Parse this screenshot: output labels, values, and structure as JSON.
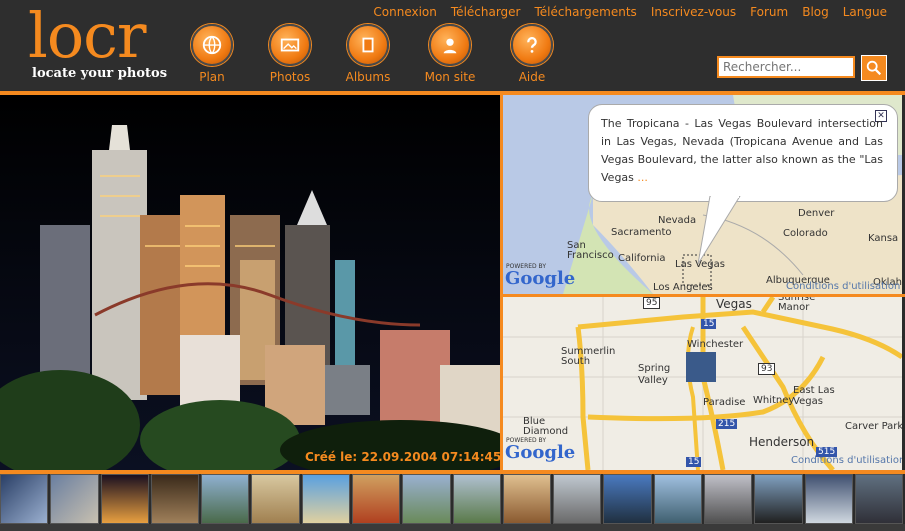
{
  "logo": {
    "name": "locr",
    "tagline": "locate your photos"
  },
  "top_links": [
    "Connexion",
    "Télécharger",
    "Téléchargements",
    "Inscrivez-vous",
    "Forum",
    "Blog",
    "Langue"
  ],
  "nav": [
    {
      "label": "Plan",
      "icon": "globe-icon"
    },
    {
      "label": "Photos",
      "icon": "photos-icon"
    },
    {
      "label": "Albums",
      "icon": "album-icon"
    },
    {
      "label": "Mon site",
      "icon": "user-icon"
    },
    {
      "label": "Aide",
      "icon": "help-icon"
    }
  ],
  "search": {
    "placeholder": "Rechercher..."
  },
  "photo": {
    "caption": "Créé le: 22.09.2004 07:14:45"
  },
  "map_overview": {
    "balloon_text": "The Tropicana - Las Vegas Boulevard intersection in Las Vegas, Nevada (Tropicana Avenue and Las Vegas Boulevard, the latter also known as the \"Las Vegas",
    "balloon_more": "...",
    "labels": [
      "Sacramento",
      "Nevada",
      "Denver",
      "Colorado",
      "Kansa",
      "San Francisco",
      "California",
      "Las Vegas",
      "Los Angeles",
      "Albuquerque",
      "Oklah"
    ],
    "powered_by": "POWERED BY",
    "google": "Google",
    "terms": "Conditions d'utilisation"
  },
  "map_detail": {
    "labels": [
      "Vegas",
      "Sunrise Manor",
      "Winchester",
      "Summerlin South",
      "Spring Valley",
      "Paradise",
      "Whitney",
      "East Las Vegas",
      "Blue Diamond",
      "Henderson",
      "Carver Park"
    ],
    "shields": [
      "95",
      "15",
      "93",
      "215",
      "515",
      "15"
    ],
    "powered_by": "POWERED BY",
    "google": "Google",
    "terms": "Conditions d'utilisation"
  },
  "colors": {
    "accent": "#f58a1f",
    "header_bg": "#2e2e2e"
  }
}
